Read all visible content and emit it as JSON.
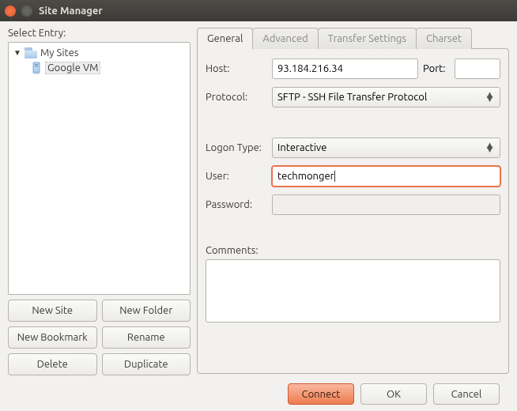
{
  "window": {
    "title": "Site Manager"
  },
  "left": {
    "select_label": "Select Entry:",
    "root_label": "My Sites",
    "site_label": "Google VM",
    "buttons": {
      "new_site": "New Site",
      "new_folder": "New Folder",
      "new_bookmark": "New Bookmark",
      "rename": "Rename",
      "delete": "Delete",
      "duplicate": "Duplicate"
    }
  },
  "tabs": {
    "general": "General",
    "advanced": "Advanced",
    "transfer": "Transfer Settings",
    "charset": "Charset"
  },
  "form": {
    "host_label": "Host:",
    "host_value": "93.184.216.34",
    "port_label": "Port:",
    "port_value": "",
    "protocol_label": "Protocol:",
    "protocol_value": "SFTP - SSH File Transfer Protocol",
    "logon_label": "Logon Type:",
    "logon_value": "Interactive",
    "user_label": "User:",
    "user_value": "techmonger",
    "password_label": "Password:",
    "password_value": "",
    "comments_label": "Comments:",
    "comments_value": ""
  },
  "footer": {
    "connect": "Connect",
    "ok": "OK",
    "cancel": "Cancel"
  }
}
